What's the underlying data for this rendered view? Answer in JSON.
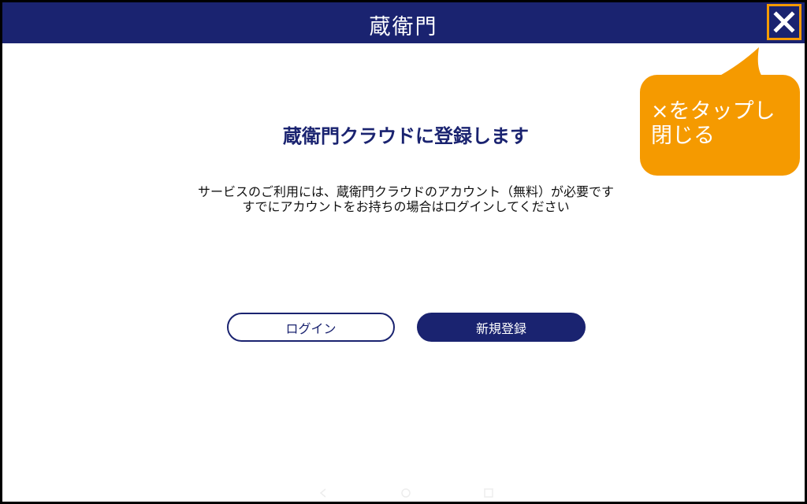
{
  "header": {
    "logo_text": "蔵衛門",
    "background_color": "#1a2370",
    "close_icon": "close-x-icon"
  },
  "main": {
    "title": "蔵衛門クラウドに登録します",
    "description_lines": [
      "サービスのご利用には、蔵衛門クラウドのアカウント（無料）が必要です",
      "すでにアカウントをお持ちの場合はログインしてください"
    ],
    "login_label": "ログイン",
    "register_label": "新規登録"
  },
  "callout": {
    "lines": [
      "×をタップし",
      "閉じる"
    ],
    "color": "#f59a00"
  },
  "system_nav": {
    "icons": [
      "back-icon",
      "home-icon",
      "recents-icon"
    ]
  }
}
